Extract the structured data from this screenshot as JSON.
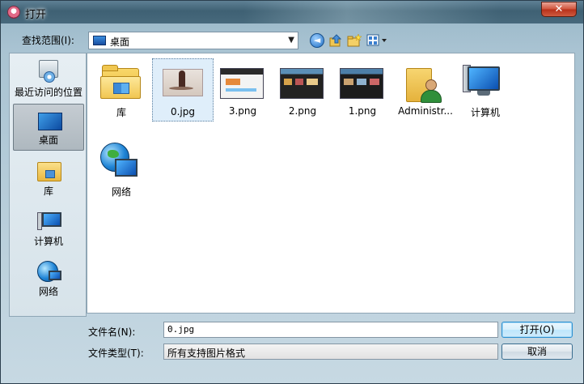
{
  "window": {
    "title": "打开",
    "close_label": "✕"
  },
  "lookin": {
    "label": "查找范围(I):",
    "value": "桌面"
  },
  "toolbar": {
    "back_glyph": "◄"
  },
  "places": [
    {
      "label": "最近访问的位置"
    },
    {
      "label": "桌面"
    },
    {
      "label": "库"
    },
    {
      "label": "计算机"
    },
    {
      "label": "网络"
    }
  ],
  "files": [
    {
      "label": "库",
      "kind": "library-folder"
    },
    {
      "label": "0.jpg",
      "kind": "photo",
      "selected": true
    },
    {
      "label": "3.png",
      "kind": "screenshot"
    },
    {
      "label": "2.png",
      "kind": "screenshot"
    },
    {
      "label": "1.png",
      "kind": "screenshot"
    },
    {
      "label": "Administr...",
      "kind": "user-folder"
    },
    {
      "label": "计算机",
      "kind": "computer"
    },
    {
      "label": "网络",
      "kind": "network"
    }
  ],
  "footer": {
    "filename_label": "文件名(N):",
    "filename_value": "0.jpg",
    "filetype_label": "文件类型(T):",
    "filetype_value": "所有支持图片格式",
    "open_label": "打开(O)",
    "cancel_label": "取消"
  }
}
